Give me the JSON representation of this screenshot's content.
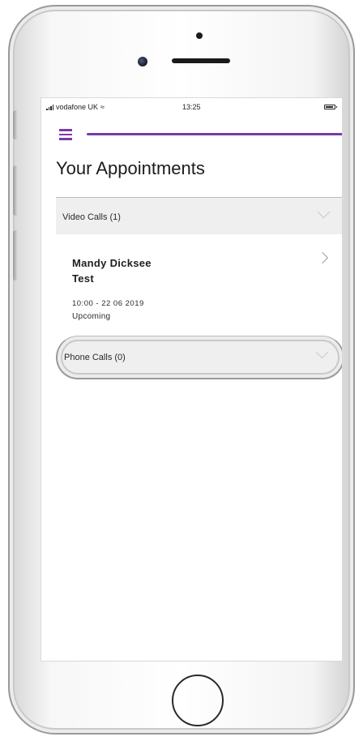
{
  "status_bar": {
    "carrier": "vodafone UK",
    "time": "13:25"
  },
  "page": {
    "title": "Your Appointments"
  },
  "sections": {
    "video_calls": {
      "label": "Video Calls (1)",
      "appointments": [
        {
          "name_line1": "Mandy Dicksee",
          "name_line2": "Test",
          "datetime": "10:00 - 22 06 2019",
          "status": "Upcoming"
        }
      ]
    },
    "phone_calls": {
      "label": "Phone Calls (0)"
    }
  },
  "colors": {
    "accent": "#7a3aa8",
    "section_background": "#efefef",
    "text": "#1c1c1c"
  },
  "icons": {
    "menu": "hamburger-menu-icon",
    "expand": "chevron-down-icon",
    "open": "chevron-right-icon",
    "signal": "signal-bars-icon",
    "wifi": "wifi-icon",
    "battery": "battery-icon"
  }
}
